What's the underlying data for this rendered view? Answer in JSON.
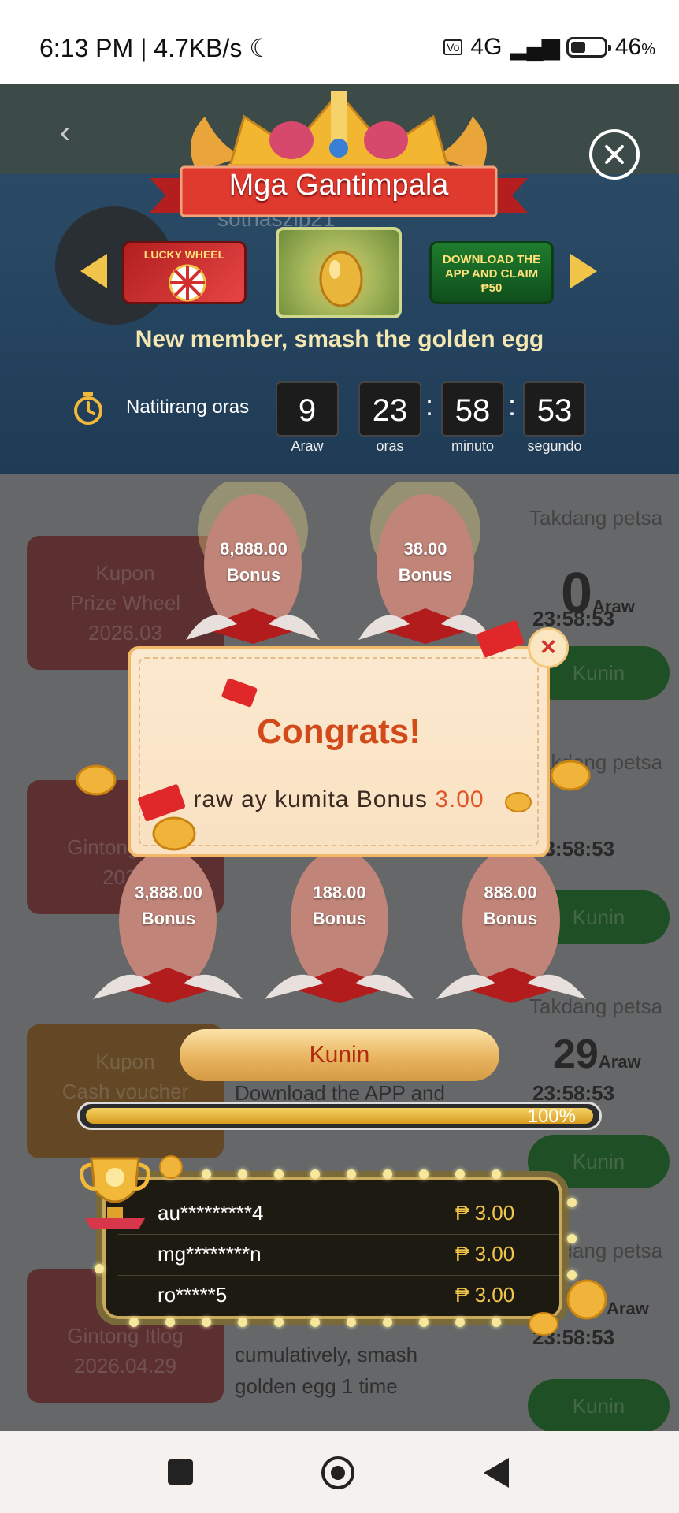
{
  "status_bar": {
    "time_speed": "6:13 PM | 4.7KB/s",
    "network": "4G",
    "battery": "46",
    "battery_unit": "%"
  },
  "background_page": {
    "username": "sotnaszip21",
    "cards": [
      {
        "type": "Kupon",
        "title": "Prize Wheel",
        "date": "2026.03"
      },
      {
        "type": "Gintong Itlog",
        "date": "2026"
      },
      {
        "type": "Kupon",
        "title": "Cash voucher"
      },
      {
        "type": "Gintong Itlog",
        "date": "2026.04.29"
      }
    ],
    "deadline_label": "Takdang petsa",
    "deadlines": [
      {
        "days": "0",
        "unit": "Araw",
        "time": "23:58:53"
      },
      {
        "days": "29",
        "unit": "Araw",
        "time": "23:58:53"
      },
      {
        "unit": "Araw",
        "time": "23:58:53"
      }
    ],
    "claim_label": "Kunin",
    "desc_download": "Download the APP and",
    "desc_cumulative": "cumulatively, smash",
    "desc_golden": "golden egg 1 time"
  },
  "header": {
    "title": "Mga Gantimpala",
    "carousel": [
      "LUCKY WHEEL",
      "",
      "DOWNLOAD THE APP AND CLAIM ₱50"
    ],
    "subtitle": "New member, smash the golden egg"
  },
  "countdown": {
    "label": "Natitirang oras",
    "days": "9",
    "days_label": "Araw",
    "hours": "23",
    "hours_label": "oras",
    "minutes": "58",
    "minutes_label": "minuto",
    "seconds": "53",
    "seconds_label": "segundo"
  },
  "eggs": [
    {
      "amount": "8,888.00",
      "label": "Bonus"
    },
    {
      "amount": "38.00",
      "label": "Bonus"
    },
    {
      "amount": "3,888.00",
      "label": "Bonus"
    },
    {
      "amount": "188.00",
      "label": "Bonus"
    },
    {
      "amount": "888.00",
      "label": "Bonus"
    }
  ],
  "popup": {
    "title": "Congrats!",
    "message": "raw ay kumita Bonus ",
    "amount": "3.00"
  },
  "claim_button": "Kunin",
  "progress": {
    "percent": 100,
    "text": "100%"
  },
  "winners": [
    {
      "name": "au*********4",
      "amount": "₱ 3.00"
    },
    {
      "name": "mg********n",
      "amount": "₱ 3.00"
    },
    {
      "name": "ro*****5",
      "amount": "₱ 3.00"
    }
  ],
  "colors": {
    "accent_gold": "#f1c54a",
    "popup_title": "#d24a1a",
    "claim_text": "#b12a12"
  }
}
